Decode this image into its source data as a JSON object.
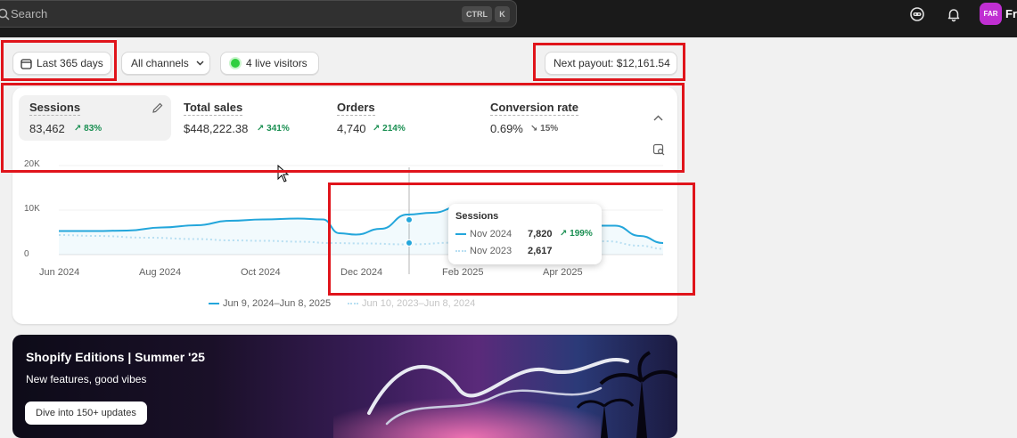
{
  "topbar": {
    "search_label": "Search",
    "shortcut_ctrl": "CTRL",
    "shortcut_k": "K",
    "avatar_initials": "FAR",
    "store_name_visible": "Fra"
  },
  "filters": {
    "date_range": "Last 365 days",
    "channels": "All channels",
    "live_visitors": "4 live visitors",
    "payout": "Next payout: $12,161.54"
  },
  "metrics": [
    {
      "label": "Sessions",
      "value": "83,462",
      "change": "83%",
      "direction": "up"
    },
    {
      "label": "Total sales",
      "value": "$448,222.38",
      "change": "341%",
      "direction": "up"
    },
    {
      "label": "Orders",
      "value": "4,740",
      "change": "214%",
      "direction": "up"
    },
    {
      "label": "Conversion rate",
      "value": "0.69%",
      "change": "15%",
      "direction": "down"
    }
  ],
  "chart_data": {
    "type": "line",
    "yticks": [
      "20K",
      "10K",
      "0"
    ],
    "ylim": [
      0,
      20000
    ],
    "xticks": [
      "Jun 2024",
      "Aug 2024",
      "Oct 2024",
      "Dec 2024",
      "Feb 2025",
      "Apr 2025"
    ],
    "series": [
      {
        "name": "Jun 9, 2024–Jun 8, 2025",
        "color": "#23a6db",
        "x": [
          "2024-06-09",
          "2024-07-01",
          "2024-07-20",
          "2024-08-10",
          "2024-08-31",
          "2024-09-20",
          "2024-10-10",
          "2024-10-31",
          "2024-11-15",
          "2024-11-25",
          "2024-12-05",
          "2024-12-20",
          "2025-01-05",
          "2025-01-20",
          "2025-02-05",
          "2025-02-20",
          "2025-03-10",
          "2025-03-30",
          "2025-04-20",
          "2025-05-10",
          "2025-05-25",
          "2025-06-08"
        ],
        "values": [
          5300,
          5300,
          5400,
          6100,
          6600,
          7600,
          7900,
          8100,
          7900,
          4800,
          4500,
          5800,
          9000,
          9400,
          10700,
          10900,
          9500,
          8400,
          6500,
          6500,
          4200,
          2600
        ]
      },
      {
        "name": "Jun 10, 2023–Jun 8, 2024",
        "color": "#b8dff2",
        "x": [
          "2024-06-09",
          "2024-07-01",
          "2024-08-01",
          "2024-08-31",
          "2024-09-20",
          "2024-10-10",
          "2024-11-01",
          "2024-11-20",
          "2024-12-10",
          "2025-01-05",
          "2025-02-05",
          "2025-03-05",
          "2025-04-05",
          "2025-05-05",
          "2025-05-25",
          "2025-06-08"
        ],
        "values": [
          4400,
          4200,
          3800,
          3500,
          3200,
          3100,
          2900,
          2600,
          2500,
          2300,
          2700,
          2900,
          3200,
          3000,
          2000,
          1300
        ]
      }
    ],
    "hover": {
      "title": "Sessions",
      "current_label": "Nov 2024",
      "current_value": "7,820",
      "change": "199%",
      "previous_label": "Nov 2023",
      "previous_value": "2,617"
    }
  },
  "banner": {
    "title": "Shopify Editions | Summer '25",
    "subtitle": "New features, good vibes",
    "button": "Dive into 150+ updates"
  },
  "colors": {
    "topbar": "#1a1a1a",
    "annotation": "#e0141b",
    "positive": "#1a8f52",
    "avatar": "#c02fd2"
  }
}
